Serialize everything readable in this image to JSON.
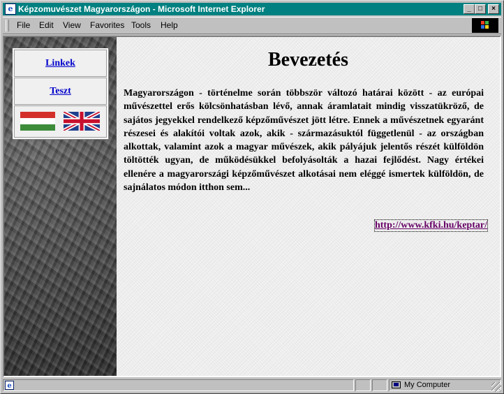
{
  "window": {
    "title": "Képzomuvészet Magyarországon - Microsoft Internet Explorer",
    "controls": {
      "minimize": "_",
      "maximize": "□",
      "close": "×"
    }
  },
  "menu": {
    "file": "File",
    "edit": "Edit",
    "view": "View",
    "favorites": "Favorites",
    "tools": "Tools",
    "help": "Help"
  },
  "sidebar": {
    "links": [
      {
        "label": "Linkek"
      },
      {
        "label": "Teszt"
      }
    ],
    "flags": [
      "hungary-flag",
      "uk-flag"
    ]
  },
  "page": {
    "heading": "Bevezetés",
    "paragraph": "Magyarországon - történelme során többször változó határai között - az európai művészettel erős kölcsönhatásban lévő, annak áramlatait mindig visszatükröző, de sajátos jegyekkel rendelkező képzőművészet jött létre. Ennek a művészetnek egyaránt részesei és alakítói voltak azok, akik - származásuktól függetlenül - az országban alkottak, valamint azok a magyar művészek, akik pályájuk jelentős részét külföldön töltötték ugyan, de működésükkel befolyásolták a hazai fejlődést. Nagy értékei ellenére a magyarországi képzőművészet alkotásai nem eléggé ismertek külföldön, de sajnálatos módon itthon sem...",
    "link": "http://www.kfki.hu/keptar/"
  },
  "status": {
    "zone": "My Computer"
  },
  "colors": {
    "titlebar": "#008080",
    "link": "#0000cc",
    "visited_link": "#660066"
  }
}
